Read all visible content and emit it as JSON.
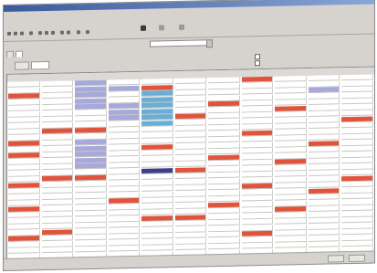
{
  "window": {
    "title": "",
    "menu": [
      "",
      ""
    ]
  },
  "toolbar": {
    "tools": [
      "new",
      "open",
      "save",
      "print",
      "cut",
      "copy",
      "paste",
      "undo",
      "redo",
      "delete",
      "help"
    ]
  },
  "filter": {
    "selected": ""
  },
  "tabs": [
    "",
    ""
  ],
  "grid": {
    "columns": 10,
    "rows": 30,
    "highlights": [
      {
        "col": 0,
        "row": 2,
        "color": "red"
      },
      {
        "col": 0,
        "row": 10,
        "color": "red"
      },
      {
        "col": 0,
        "row": 12,
        "color": "red"
      },
      {
        "col": 0,
        "row": 17,
        "color": "red"
      },
      {
        "col": 0,
        "row": 21,
        "color": "red"
      },
      {
        "col": 0,
        "row": 26,
        "color": "red"
      },
      {
        "col": 1,
        "row": 8,
        "color": "red"
      },
      {
        "col": 1,
        "row": 16,
        "color": "red"
      },
      {
        "col": 1,
        "row": 25,
        "color": "red"
      },
      {
        "col": 2,
        "row": 0,
        "color": "lav"
      },
      {
        "col": 2,
        "row": 1,
        "color": "lav"
      },
      {
        "col": 2,
        "row": 2,
        "color": "lav"
      },
      {
        "col": 2,
        "row": 3,
        "color": "lav"
      },
      {
        "col": 2,
        "row": 4,
        "color": "lav"
      },
      {
        "col": 2,
        "row": 8,
        "color": "red"
      },
      {
        "col": 2,
        "row": 10,
        "color": "lav"
      },
      {
        "col": 2,
        "row": 11,
        "color": "lav"
      },
      {
        "col": 2,
        "row": 12,
        "color": "lav"
      },
      {
        "col": 2,
        "row": 13,
        "color": "lav"
      },
      {
        "col": 2,
        "row": 14,
        "color": "lav"
      },
      {
        "col": 2,
        "row": 16,
        "color": "red"
      },
      {
        "col": 3,
        "row": 1,
        "color": "lav"
      },
      {
        "col": 3,
        "row": 4,
        "color": "lav"
      },
      {
        "col": 3,
        "row": 5,
        "color": "lav"
      },
      {
        "col": 3,
        "row": 6,
        "color": "lav"
      },
      {
        "col": 3,
        "row": 20,
        "color": "red"
      },
      {
        "col": 4,
        "row": 1,
        "color": "red"
      },
      {
        "col": 4,
        "row": 2,
        "color": "blue"
      },
      {
        "col": 4,
        "row": 3,
        "color": "blue"
      },
      {
        "col": 4,
        "row": 4,
        "color": "blue"
      },
      {
        "col": 4,
        "row": 5,
        "color": "blue"
      },
      {
        "col": 4,
        "row": 6,
        "color": "blue"
      },
      {
        "col": 4,
        "row": 7,
        "color": "blue"
      },
      {
        "col": 4,
        "row": 11,
        "color": "red"
      },
      {
        "col": 4,
        "row": 15,
        "color": "navy"
      },
      {
        "col": 4,
        "row": 23,
        "color": "red"
      },
      {
        "col": 5,
        "row": 6,
        "color": "red"
      },
      {
        "col": 5,
        "row": 15,
        "color": "red"
      },
      {
        "col": 5,
        "row": 23,
        "color": "red"
      },
      {
        "col": 6,
        "row": 4,
        "color": "red"
      },
      {
        "col": 6,
        "row": 13,
        "color": "red"
      },
      {
        "col": 6,
        "row": 21,
        "color": "red"
      },
      {
        "col": 7,
        "row": 0,
        "color": "red"
      },
      {
        "col": 7,
        "row": 9,
        "color": "red"
      },
      {
        "col": 7,
        "row": 18,
        "color": "red"
      },
      {
        "col": 7,
        "row": 26,
        "color": "red"
      },
      {
        "col": 8,
        "row": 5,
        "color": "red"
      },
      {
        "col": 8,
        "row": 14,
        "color": "red"
      },
      {
        "col": 8,
        "row": 22,
        "color": "red"
      },
      {
        "col": 9,
        "row": 2,
        "color": "lav"
      },
      {
        "col": 9,
        "row": 11,
        "color": "red"
      },
      {
        "col": 9,
        "row": 19,
        "color": "red"
      },
      {
        "col": 10,
        "row": 7,
        "color": "red"
      },
      {
        "col": 10,
        "row": 17,
        "color": "red"
      }
    ]
  },
  "status": {
    "buttons": [
      "",
      ""
    ]
  }
}
